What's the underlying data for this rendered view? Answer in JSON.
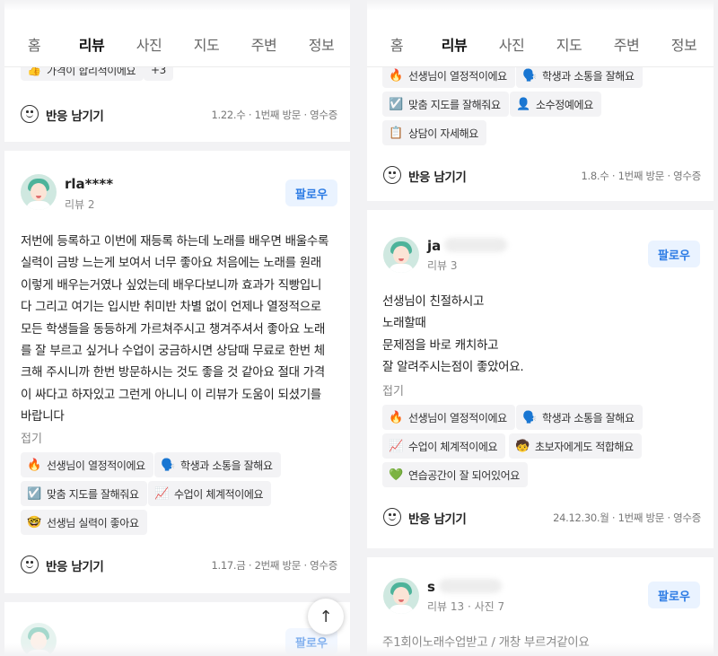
{
  "tabs": [
    "홈",
    "리뷰",
    "사진",
    "지도",
    "주변",
    "정보"
  ],
  "active_tab": "리뷰",
  "react_label": "반응 남기기",
  "follow_label": "팔로우",
  "fold_label": "접기",
  "left": {
    "prev_review": {
      "tags": [
        {
          "emoji": "👍",
          "label": "가격이 합리적이에요"
        },
        {
          "emoji": "",
          "label": "+3"
        }
      ],
      "meta": "1.22.수 · 1번째 방문 · 영수증"
    },
    "review": {
      "nickname": "rla****",
      "sub": "리뷰 2",
      "lines": [
        "저번에 등록하고 이번에 재등록 하는데 노래를 배우면 배울수록",
        "실력이 금방 느는게 보여서 너무 좋아요 처음에는 노래를 원래",
        "이렇게 배우는거였나 싶었는데 배우다보니까 효과가 직빵입니",
        "다 그리고 여기는 입시반 취미반 차별 없이 언제나 열정적으로",
        "모든 학생들을 동등하게 가르쳐주시고 챙겨주셔서 좋아요 노래",
        "를 잘 부르고 싶거나 수업이 궁금하시면 상담때 무료로 한번 체",
        "크해 주시니까 한번 방문하시는 것도 좋을 것 같아요 절대 가격",
        "이 싸다고 하자있고 그런게 아니니 이 리뷰가 도움이 되셨기를",
        "바랍니다"
      ],
      "tags": [
        {
          "emoji": "🔥",
          "label": "선생님이 열정적이에요"
        },
        {
          "emoji": "🗣️",
          "label": "학생과 소통을 잘해요"
        },
        {
          "emoji": "☑️",
          "label": "맞춤 지도를 잘해줘요"
        },
        {
          "emoji": "📈",
          "label": "수업이 체계적이에요"
        },
        {
          "emoji": "🤓",
          "label": "선생님 실력이 좋아요"
        }
      ],
      "meta": "1.17.금 · 2번째 방문 · 영수증"
    },
    "next_review": {
      "follow_label": "팔로우"
    },
    "scroll_top_icon": "↑"
  },
  "right": {
    "prev_review": {
      "tags": [
        {
          "emoji": "🔥",
          "label": "선생님이 열정적이에요"
        },
        {
          "emoji": "🗣️",
          "label": "학생과 소통을 잘해요"
        },
        {
          "emoji": "☑️",
          "label": "맞춤 지도를 잘해줘요"
        },
        {
          "emoji": "👤",
          "label": "소수정예에요"
        },
        {
          "emoji": "📋",
          "label": "상담이 자세해요"
        }
      ],
      "meta": "1.8.수 · 1번째 방문 · 영수증"
    },
    "review": {
      "nickname": "ja",
      "sub": "리뷰 3",
      "lines": [
        "선생님이 친절하시고",
        "노래할때",
        "문제점을 바로 캐치하고",
        "잘 알려주시는점이 좋았어요."
      ],
      "tags": [
        {
          "emoji": "🔥",
          "label": "선생님이 열정적이에요"
        },
        {
          "emoji": "🗣️",
          "label": "학생과 소통을 잘해요"
        },
        {
          "emoji": "📈",
          "label": "수업이 체계적이에요"
        },
        {
          "emoji": "🧒",
          "label": "초보자에게도 적합해요"
        },
        {
          "emoji": "💚",
          "label": "연습공간이 잘 되어있어요"
        }
      ],
      "meta": "24.12.30.월 · 1번째 방문 · 영수증"
    },
    "next_review": {
      "nickname": "s",
      "sub": "리뷰 13 · 사진 7",
      "first_line": "주1회이노래수업받고 / 개창 부르겨같이요"
    }
  }
}
